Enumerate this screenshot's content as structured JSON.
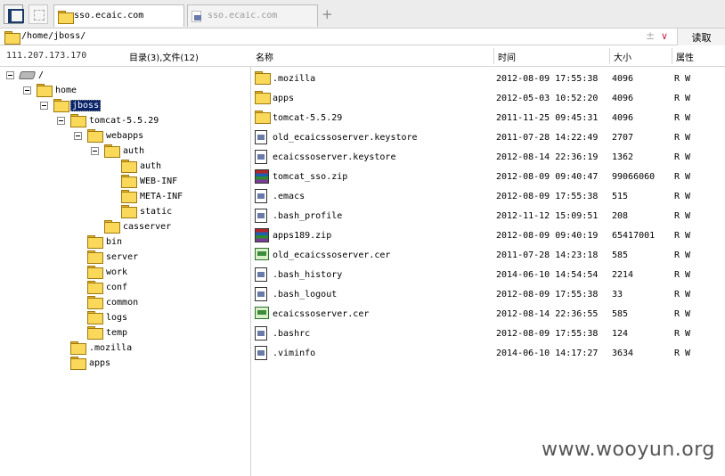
{
  "tabs": [
    {
      "title": "sso.ecaic.com",
      "active": true
    },
    {
      "title": "sso.ecaic.com",
      "active": false
    }
  ],
  "tab_add_label": "+",
  "address": {
    "path": "/home/jboss/",
    "pm_icon": "±",
    "chevron": "∨",
    "read_button": "读取"
  },
  "info": {
    "ip": "111.207.173.170",
    "counts": "目录(3),文件(12)"
  },
  "columns": {
    "name": "名称",
    "time": "时间",
    "size": "大小",
    "attr": "属性"
  },
  "tree": [
    {
      "label": "/",
      "icon": "drive-icon"
    },
    {
      "label": "home",
      "icon": "folder-icon"
    },
    {
      "label": "jboss",
      "icon": "folder-icon",
      "selected": true
    },
    {
      "label": "tomcat-5.5.29",
      "icon": "folder-icon"
    },
    {
      "label": "webapps",
      "icon": "folder-icon"
    },
    {
      "label": "auth",
      "icon": "folder-icon"
    },
    {
      "label": "auth",
      "icon": "folder-icon"
    },
    {
      "label": "WEB-INF",
      "icon": "folder-icon"
    },
    {
      "label": "META-INF",
      "icon": "folder-icon"
    },
    {
      "label": "static",
      "icon": "folder-icon"
    },
    {
      "label": "casserver",
      "icon": "folder-icon"
    },
    {
      "label": "bin",
      "icon": "folder-icon"
    },
    {
      "label": "server",
      "icon": "folder-icon"
    },
    {
      "label": "work",
      "icon": "folder-icon"
    },
    {
      "label": "conf",
      "icon": "folder-icon"
    },
    {
      "label": "common",
      "icon": "folder-icon"
    },
    {
      "label": "logs",
      "icon": "folder-icon"
    },
    {
      "label": "temp",
      "icon": "folder-icon"
    },
    {
      "label": ".mozilla",
      "icon": "folder-icon"
    },
    {
      "label": "apps",
      "icon": "folder-icon"
    }
  ],
  "files": [
    {
      "name": ".mozilla",
      "time": "2012-08-09 17:55:38",
      "size": "4096",
      "attr": "R W",
      "type": "folder"
    },
    {
      "name": "apps",
      "time": "2012-05-03 10:52:20",
      "size": "4096",
      "attr": "R W",
      "type": "folder"
    },
    {
      "name": "tomcat-5.5.29",
      "time": "2011-11-25 09:45:31",
      "size": "4096",
      "attr": "R W",
      "type": "folder"
    },
    {
      "name": "old_ecaicssoserver.keystore",
      "time": "2011-07-28 14:22:49",
      "size": "2707",
      "attr": "R W",
      "type": "doc"
    },
    {
      "name": "ecaicssoserver.keystore",
      "time": "2012-08-14 22:36:19",
      "size": "1362",
      "attr": "R W",
      "type": "doc"
    },
    {
      "name": "tomcat_sso.zip",
      "time": "2012-08-09 09:40:47",
      "size": "99066060",
      "attr": "R W",
      "type": "zip"
    },
    {
      "name": ".emacs",
      "time": "2012-08-09 17:55:38",
      "size": "515",
      "attr": "R W",
      "type": "doc"
    },
    {
      "name": ".bash_profile",
      "time": "2012-11-12 15:09:51",
      "size": "208",
      "attr": "R W",
      "type": "doc"
    },
    {
      "name": "apps189.zip",
      "time": "2012-08-09 09:40:19",
      "size": "65417001",
      "attr": "R W",
      "type": "zip"
    },
    {
      "name": "old_ecaicssoserver.cer",
      "time": "2011-07-28 14:23:18",
      "size": "585",
      "attr": "R W",
      "type": "cer"
    },
    {
      "name": ".bash_history",
      "time": "2014-06-10 14:54:54",
      "size": "2214",
      "attr": "R W",
      "type": "doc"
    },
    {
      "name": ".bash_logout",
      "time": "2012-08-09 17:55:38",
      "size": "33",
      "attr": "R W",
      "type": "doc"
    },
    {
      "name": "ecaicssoserver.cer",
      "time": "2012-08-14 22:36:55",
      "size": "585",
      "attr": "R W",
      "type": "cer"
    },
    {
      "name": ".bashrc",
      "time": "2012-08-09 17:55:38",
      "size": "124",
      "attr": "R W",
      "type": "doc"
    },
    {
      "name": ".viminfo",
      "time": "2014-06-10 14:17:27",
      "size": "3634",
      "attr": "R W",
      "type": "doc"
    }
  ],
  "watermark": "www.wooyun.org"
}
